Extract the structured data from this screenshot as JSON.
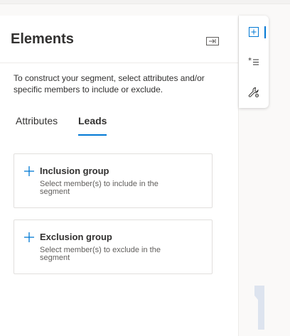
{
  "panel": {
    "title": "Elements",
    "description": "To construct your segment, select attributes and/or specific members to include or exclude."
  },
  "tabs": [
    {
      "label": "Attributes",
      "active": false
    },
    {
      "label": "Leads",
      "active": true
    }
  ],
  "groups": [
    {
      "title": "Inclusion group",
      "subtitle": "Select member(s) to include in the segment"
    },
    {
      "title": "Exclusion group",
      "subtitle": "Select member(s) to exclude in the segment"
    }
  ],
  "rail": {
    "items": [
      {
        "icon": "add-element-icon",
        "selected": true
      },
      {
        "icon": "list-bullet-icon",
        "selected": false
      },
      {
        "icon": "wrench-settings-icon",
        "selected": false
      }
    ]
  },
  "colors": {
    "accent": "#0078d4",
    "text": "#323130",
    "subtext": "#605e5c",
    "border": "#e1dfdd"
  }
}
